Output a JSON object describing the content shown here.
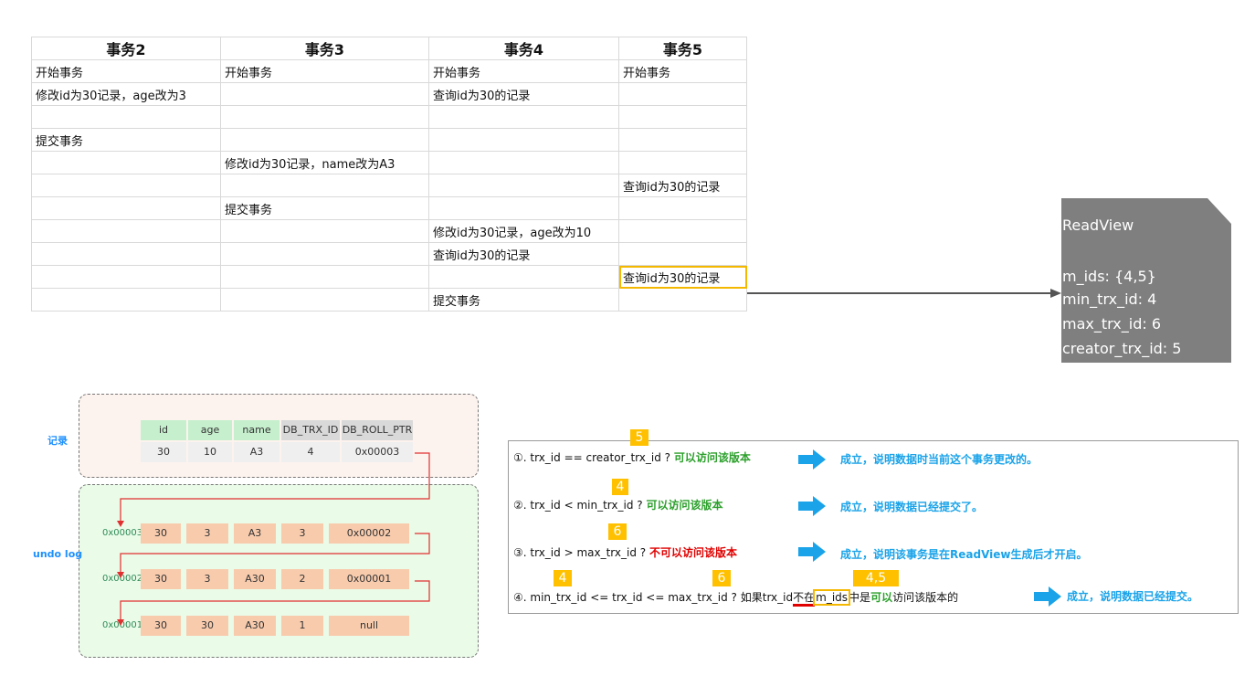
{
  "table": {
    "headers": [
      "事务2",
      "事务3",
      "事务4",
      "事务5"
    ],
    "rows": [
      [
        "开始事务",
        "开始事务",
        "开始事务",
        "开始事务"
      ],
      [
        "修改id为30记录，age改为3",
        "",
        "查询id为30的记录",
        ""
      ],
      [
        "",
        "",
        "",
        ""
      ],
      [
        "提交事务",
        "",
        "",
        ""
      ],
      [
        "",
        "修改id为30记录，name改为A3",
        "",
        ""
      ],
      [
        "",
        "",
        "",
        "查询id为30的记录"
      ],
      [
        "",
        "提交事务",
        "",
        ""
      ],
      [
        "",
        "",
        "修改id为30记录，age改为10",
        ""
      ],
      [
        "",
        "",
        "查询id为30的记录",
        ""
      ],
      [
        "",
        "",
        "",
        "查询id为30的记录"
      ],
      [
        "",
        "",
        "提交事务",
        ""
      ]
    ]
  },
  "readview": {
    "title": "ReadView",
    "m_ids": "m_ids: {4,5}",
    "min_trx_id": "min_trx_id: 4",
    "max_trx_id": "max_trx_id: 6",
    "creator_trx_id": "creator_trx_id: 5"
  },
  "record": {
    "label": "记录",
    "columns": [
      "id",
      "age",
      "name",
      "DB_TRX_ID",
      "DB_ROLL_PTR"
    ],
    "row": [
      "30",
      "10",
      "A3",
      "4",
      "0x00003"
    ]
  },
  "undo": {
    "label": "undo log",
    "rows": [
      {
        "addr": "0x00003",
        "cells": [
          "30",
          "3",
          "A3",
          "3",
          "0x00002"
        ]
      },
      {
        "addr": "0x00002",
        "cells": [
          "30",
          "3",
          "A30",
          "2",
          "0x00001"
        ]
      },
      {
        "addr": "0x00001",
        "cells": [
          "30",
          "30",
          "A30",
          "1",
          "null"
        ]
      }
    ]
  },
  "rules": {
    "r1": {
      "cond": "①. trx_id  == creator_trx_id ?",
      "access": "可以访问该版本",
      "result": "成立，说明数据时当前这个事务更改的。",
      "badge": "5"
    },
    "r2": {
      "cond": "②. trx_id < min_trx_id ?",
      "access": "可以访问该版本",
      "result": "成立，说明数据已经提交了。",
      "badge": "4"
    },
    "r3": {
      "cond": "③. trx_id > max_trx_id ?",
      "access": "不可以访问该版本",
      "result": "成立，说明该事务是在ReadView生成后才开启。",
      "badge": "6"
    },
    "r4": {
      "cond_a": "④. min_trx_id <= trx_id <= max_trx_id ? 如果trx_id",
      "not_in": "不在",
      "m_ids": "m_ids",
      "mid": "中是",
      "access": "可以",
      "tail": "访问该版本的",
      "result": "成立，说明数据已经提交。",
      "badge_a": "4",
      "badge_b": "6",
      "badge_c": "4,5"
    }
  },
  "colors": {
    "highlight": "#f5b800",
    "readview_bg": "#7f7f7f",
    "arrow_blue": "#1aa3e8",
    "badge": "#ffc000"
  }
}
